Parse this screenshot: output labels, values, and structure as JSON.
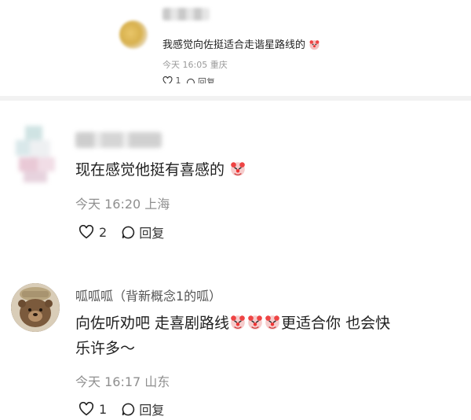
{
  "top_comment": {
    "text": "我感觉向佐挺适合走谐星路线的",
    "time": "今天 16:05",
    "location": "重庆",
    "likes": "1",
    "reply_label": "回复"
  },
  "comment1": {
    "text": "现在感觉他挺有喜感的",
    "time": "今天 16:20",
    "location": "上海",
    "likes": "2",
    "reply_label": "回复"
  },
  "comment2": {
    "username": "呱呱呱（背新概念1的呱）",
    "text_line1_part1": "向佐听劝吧 走喜剧路线",
    "text_line1_part2": "更适合你 也会快",
    "text_line2": "乐许多～",
    "time": "今天 16:17",
    "location": "山东",
    "likes": "1",
    "reply_label": "回复"
  },
  "colors": {
    "text": "#1f1f1f",
    "meta": "#8f8f8f",
    "divider": "#f2f2f2"
  },
  "icons": [
    "heart-icon",
    "comment-icon",
    "clown-face-emoji"
  ]
}
